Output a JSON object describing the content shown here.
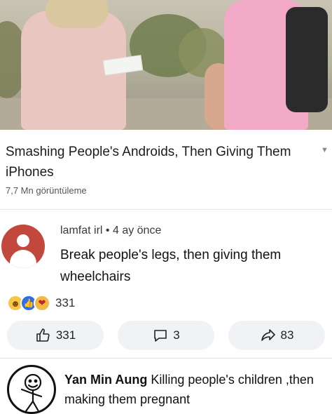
{
  "video": {
    "title": "Smashing People's Androids, Then Giving Them iPhones",
    "views": "7,7 Mn görüntüleme"
  },
  "comment": {
    "author": "lamfat irl",
    "separator": "•",
    "time": "4 ay önce",
    "text": "Break people's legs, then giving them wheelchairs",
    "reaction_count": "331",
    "reaction_icons": [
      "haha-icon",
      "like-icon",
      "care-icon"
    ]
  },
  "actions": {
    "like_count": "331",
    "comment_count": "3",
    "share_count": "83"
  },
  "reply": {
    "author": "Yan Min Aung",
    "text": "Killing people's children ,then making them pregnant"
  },
  "colors": {
    "avatar_bg": "#c2473c",
    "pill_bg": "#f0f2f5",
    "like_blue": "#2f6fe6"
  }
}
